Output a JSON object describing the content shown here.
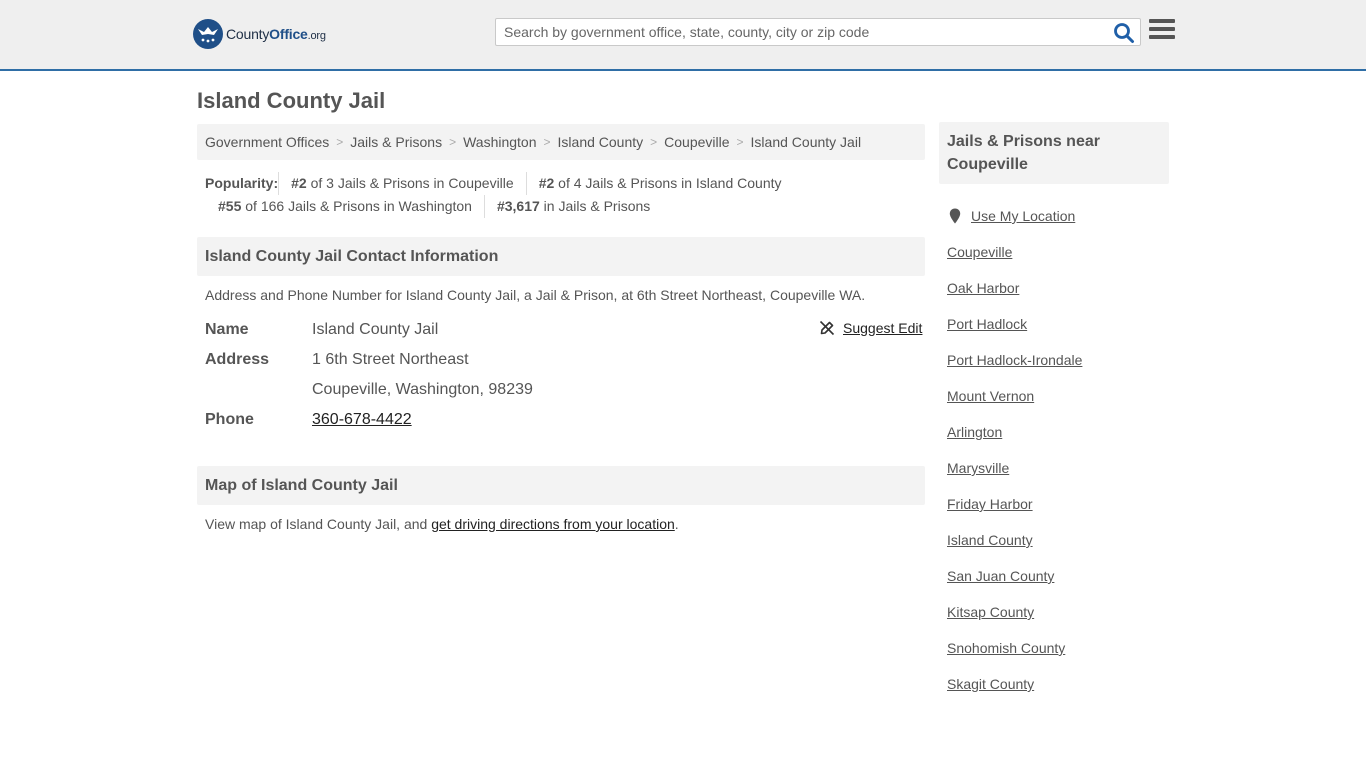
{
  "header": {
    "logo": {
      "brand": "County",
      "brand_bold": "Office",
      "tld": ".org"
    },
    "search": {
      "placeholder": "Search by government office, state, county, city or zip code"
    },
    "icons": {
      "search": "search-icon",
      "menu": "hamburger-menu-icon"
    },
    "accent_color": "#2f6ea6"
  },
  "main": {
    "title": "Island County Jail",
    "breadcrumb": [
      "Government Offices",
      "Jails & Prisons",
      "Washington",
      "Island County",
      "Coupeville",
      "Island County Jail"
    ],
    "popularity": {
      "label": "Popularity:",
      "items": [
        {
          "rank": "#2",
          "text": " of 3 Jails & Prisons in Coupeville"
        },
        {
          "rank": "#2",
          "text": " of 4 Jails & Prisons in Island County"
        },
        {
          "rank": "#55",
          "text": " of 166 Jails & Prisons in Washington"
        },
        {
          "rank": "#3,617",
          "text": " in Jails & Prisons"
        }
      ]
    },
    "contact": {
      "heading": "Island County Jail Contact Information",
      "description": "Address and Phone Number for Island County Jail, a Jail & Prison, at 6th Street Northeast, Coupeville WA.",
      "suggest_edit": "Suggest Edit",
      "fields": {
        "name_label": "Name",
        "name_value": "Island County Jail",
        "address_label": "Address",
        "address_line1": "1 6th Street Northeast",
        "address_line2": "Coupeville, Washington, 98239",
        "phone_label": "Phone",
        "phone_value": "360-678-4422"
      }
    },
    "map": {
      "heading": "Map of Island County Jail",
      "description_prefix": "View map of Island County Jail, and ",
      "description_link": "get driving directions from your location",
      "description_suffix": "."
    }
  },
  "sidebar": {
    "heading": "Jails & Prisons near Coupeville",
    "use_location": "Use My Location",
    "links": [
      "Coupeville",
      "Oak Harbor",
      "Port Hadlock",
      "Port Hadlock-Irondale",
      "Mount Vernon",
      "Arlington",
      "Marysville",
      "Friday Harbor",
      "Island County",
      "San Juan County",
      "Kitsap County",
      "Snohomish County",
      "Skagit County"
    ]
  }
}
